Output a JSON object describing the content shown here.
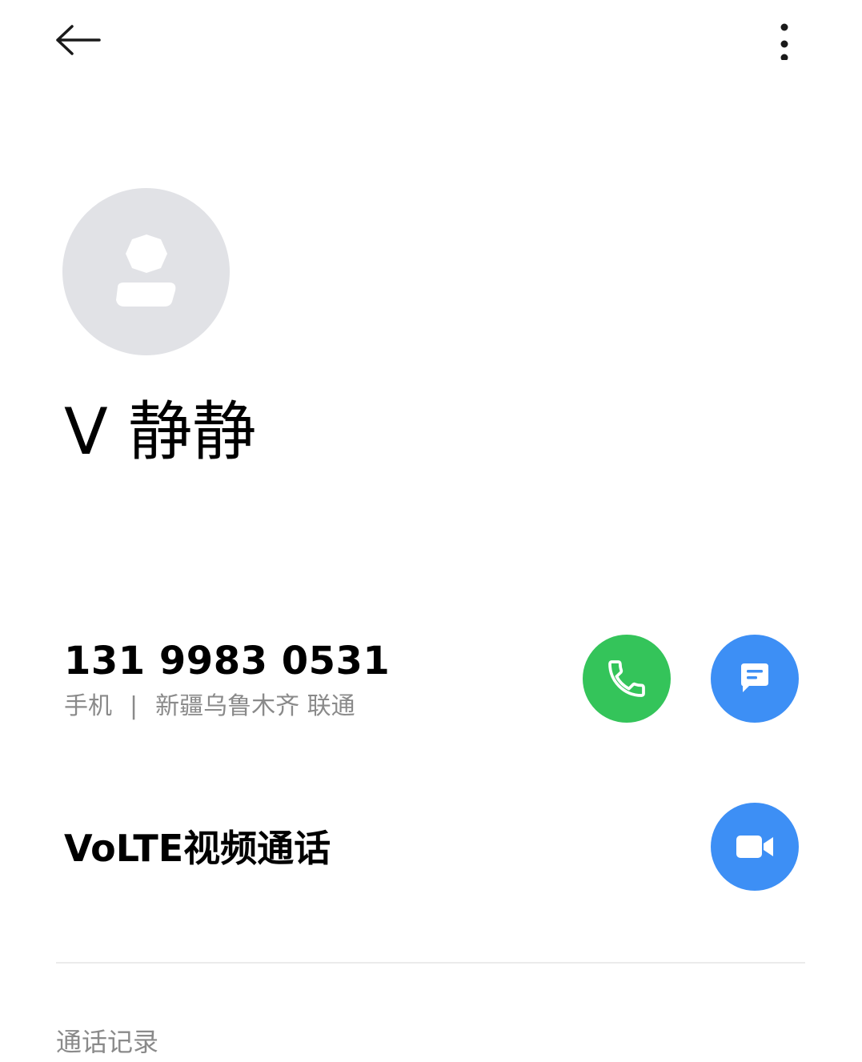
{
  "header": {
    "back_icon": "arrow-left-icon",
    "more_icon": "more-vertical-icon"
  },
  "contact": {
    "avatar_icon": "person-placeholder-icon",
    "name": "V 静静"
  },
  "phone": {
    "number": "131 9983 0531",
    "type": "手机",
    "separator": "|",
    "location": "新疆乌鲁木齐 联通",
    "call_icon": "phone-icon",
    "call_color": "#34c45a",
    "message_icon": "message-icon",
    "message_color": "#3d8ff5"
  },
  "volte": {
    "label": "VoLTE视频通话",
    "video_icon": "video-camera-icon",
    "video_color": "#3d8ff5"
  },
  "history": {
    "label": "通话记录"
  }
}
